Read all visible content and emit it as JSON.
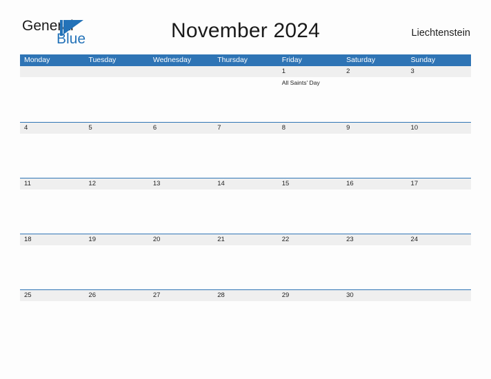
{
  "brand": {
    "name_part1": "General",
    "name_part2": "Blue",
    "mark_icon": "triangle-flag-icon",
    "accent_color": "#2372b8"
  },
  "header": {
    "title": "November 2024",
    "region": "Liechtenstein"
  },
  "colors": {
    "header_blue": "#2e74b5",
    "row_band_gray": "#efefef",
    "page_background": "#fdfdfd",
    "text_dark": "#1a1a1a"
  },
  "calendar": {
    "month": "November",
    "year": "2024",
    "day_headers": [
      "Monday",
      "Tuesday",
      "Wednesday",
      "Thursday",
      "Friday",
      "Saturday",
      "Sunday"
    ],
    "weeks": [
      [
        {
          "date": "",
          "events": []
        },
        {
          "date": "",
          "events": []
        },
        {
          "date": "",
          "events": []
        },
        {
          "date": "",
          "events": []
        },
        {
          "date": "1",
          "events": [
            "All Saints' Day"
          ]
        },
        {
          "date": "2",
          "events": []
        },
        {
          "date": "3",
          "events": []
        }
      ],
      [
        {
          "date": "4",
          "events": []
        },
        {
          "date": "5",
          "events": []
        },
        {
          "date": "6",
          "events": []
        },
        {
          "date": "7",
          "events": []
        },
        {
          "date": "8",
          "events": []
        },
        {
          "date": "9",
          "events": []
        },
        {
          "date": "10",
          "events": []
        }
      ],
      [
        {
          "date": "11",
          "events": []
        },
        {
          "date": "12",
          "events": []
        },
        {
          "date": "13",
          "events": []
        },
        {
          "date": "14",
          "events": []
        },
        {
          "date": "15",
          "events": []
        },
        {
          "date": "16",
          "events": []
        },
        {
          "date": "17",
          "events": []
        }
      ],
      [
        {
          "date": "18",
          "events": []
        },
        {
          "date": "19",
          "events": []
        },
        {
          "date": "20",
          "events": []
        },
        {
          "date": "21",
          "events": []
        },
        {
          "date": "22",
          "events": []
        },
        {
          "date": "23",
          "events": []
        },
        {
          "date": "24",
          "events": []
        }
      ],
      [
        {
          "date": "25",
          "events": []
        },
        {
          "date": "26",
          "events": []
        },
        {
          "date": "27",
          "events": []
        },
        {
          "date": "28",
          "events": []
        },
        {
          "date": "29",
          "events": []
        },
        {
          "date": "30",
          "events": []
        },
        {
          "date": "",
          "events": []
        }
      ]
    ]
  }
}
